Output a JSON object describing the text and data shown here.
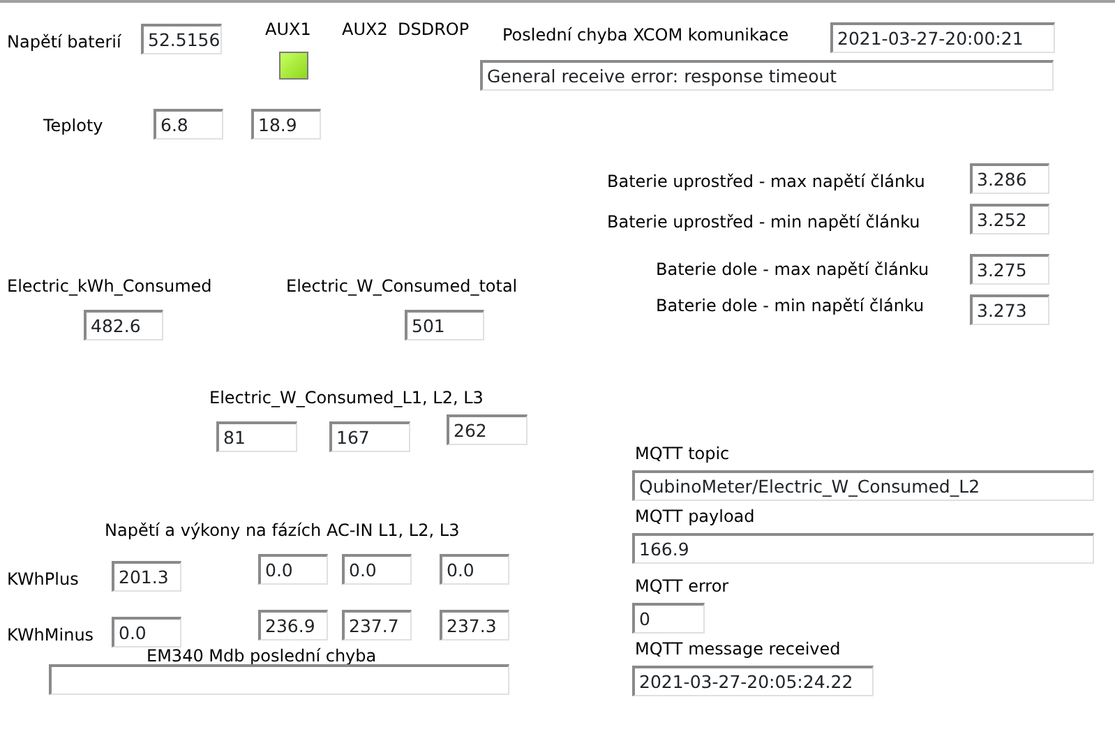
{
  "labels": [
    "Napětí baterií",
    "AUX1",
    "AUX2",
    "DSDROP",
    "Poslední chyba XCOM komunikace",
    "Teploty",
    "Baterie uprostřed - max napětí článku",
    "Baterie uprostřed - min napětí článku",
    "Baterie dole - max napětí článku",
    "Baterie dole - min napětí článku",
    "Electric_kWh_Consumed",
    "Electric_W_Consumed_total",
    "Electric_W_Consumed_L1, L2, L3",
    "MQTT topic",
    "MQTT payload",
    "Napětí a výkony na fázích AC-IN L1, L2, L3",
    "KWhPlus",
    "MQTT error",
    "KWhMinus",
    "EM340 Mdb poslední chyba",
    "MQTT message received"
  ],
  "aux1_indicator": {
    "on": true
  },
  "fields": [
    {
      "value": "52.5156"
    },
    {
      "value": "2021-03-27-20:00:21"
    },
    {
      "value": "General receive error: response timeout"
    },
    {
      "value": "6.8"
    },
    {
      "value": "18.9"
    },
    {
      "value": "3.286"
    },
    {
      "value": "3.252"
    },
    {
      "value": "3.275"
    },
    {
      "value": "3.273"
    },
    {
      "value": "482.6"
    },
    {
      "value": "501"
    },
    {
      "value": "81"
    },
    {
      "value": "167"
    },
    {
      "value": "262"
    },
    {
      "value": "QubinoMeter/Electric_W_Consumed_L2"
    },
    {
      "value": "166.9"
    },
    {
      "value": "201.3"
    },
    {
      "value": "0.0"
    },
    {
      "value": "0.0"
    },
    {
      "value": "0.0"
    },
    {
      "value": "0.0"
    },
    {
      "value": "236.9"
    },
    {
      "value": "237.7"
    },
    {
      "value": "237.3"
    },
    {
      "value": "0"
    },
    {
      "value": "2021-03-27-20:05:24.22"
    }
  ]
}
